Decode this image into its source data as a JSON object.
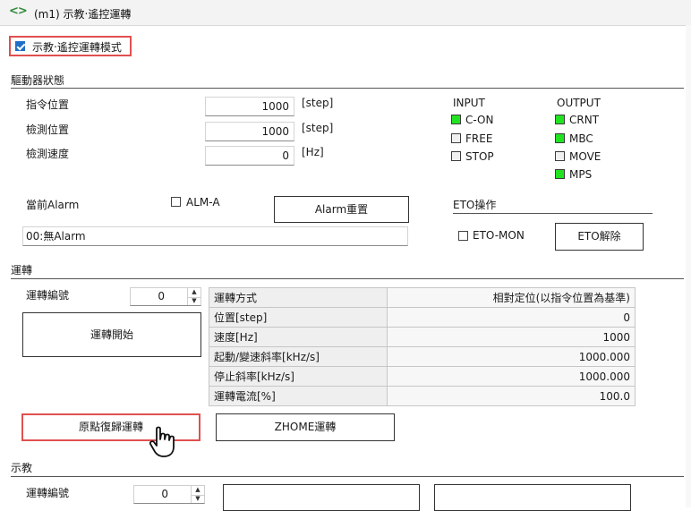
{
  "window": {
    "icon": "sync-icon",
    "title": "(m1) 示教‧遙控運轉"
  },
  "mode_checkbox": {
    "label": "示教‧遙控運轉模式",
    "checked": true
  },
  "driver_status": {
    "section_title": "驅動器狀態",
    "command_position": {
      "label": "指令位置",
      "value": "1000",
      "unit": "[step]"
    },
    "detected_position": {
      "label": "檢測位置",
      "value": "1000",
      "unit": "[step]"
    },
    "detected_speed": {
      "label": "檢測速度",
      "value": "0",
      "unit": "[Hz]"
    },
    "input": {
      "title": "INPUT",
      "items": [
        {
          "label": "C-ON",
          "on": true
        },
        {
          "label": "FREE",
          "on": false
        },
        {
          "label": "STOP",
          "on": false
        }
      ]
    },
    "output": {
      "title": "OUTPUT",
      "items": [
        {
          "label": "CRNT",
          "on": true
        },
        {
          "label": "MBC",
          "on": true
        },
        {
          "label": "MOVE",
          "on": false
        },
        {
          "label": "MPS",
          "on": true
        }
      ]
    },
    "current_alarm": {
      "label": "當前Alarm",
      "value": "00:無Alarm"
    },
    "alm_a": {
      "label": "ALM-A",
      "checked": false
    },
    "alarm_reset_button": "Alarm重置",
    "eto": {
      "title": "ETO操作",
      "eto_mon_label": "ETO-MON",
      "eto_mon_checked": false,
      "release_button": "ETO解除"
    }
  },
  "operation": {
    "section_title": "運轉",
    "op_number": {
      "label": "運轉編號",
      "value": "0"
    },
    "start_button": "運轉開始",
    "table": [
      {
        "key": "運轉方式",
        "value": "相對定位(以指令位置為基準)"
      },
      {
        "key": "位置[step]",
        "value": "0"
      },
      {
        "key": "速度[Hz]",
        "value": "1000"
      },
      {
        "key": "起動/變速斜率[kHz/s]",
        "value": "1000.000"
      },
      {
        "key": "停止斜率[kHz/s]",
        "value": "1000.000"
      },
      {
        "key": "運轉電流[%]",
        "value": "100.0"
      }
    ],
    "home_return_button": "原點復歸運轉",
    "zhome_button": "ZHOME運轉"
  },
  "teaching": {
    "section_title": "示教",
    "op_number": {
      "label": "運轉編號",
      "value": "0"
    }
  },
  "colors": {
    "led_on": "#22e322",
    "highlight": "#e05050",
    "checkbox_checked": "#1f6fc7"
  }
}
